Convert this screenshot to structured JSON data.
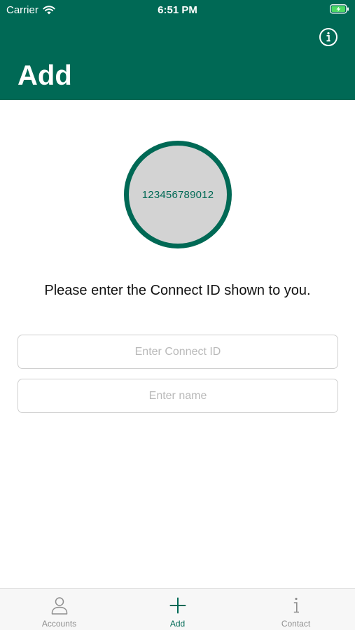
{
  "status_bar": {
    "carrier": "Carrier",
    "time": "6:51 PM"
  },
  "header": {
    "title": "Add",
    "info_icon": "info-circle-icon"
  },
  "connect_circle": {
    "id_value": "123456789012"
  },
  "instruction": "Please enter the Connect ID shown to you.",
  "form": {
    "connect_id_placeholder": "Enter Connect ID",
    "connect_id_value": "",
    "name_placeholder": "Enter name",
    "name_value": ""
  },
  "tabs": [
    {
      "label": "Accounts",
      "icon": "person-icon",
      "active": false
    },
    {
      "label": "Add",
      "icon": "plus-icon",
      "active": true
    },
    {
      "label": "Contact",
      "icon": "info-i-icon",
      "active": false
    }
  ],
  "colors": {
    "brand": "#006955",
    "circle_fill": "#d3d3d3",
    "inactive_tab": "#8e8e8e",
    "battery_charging": "#4cd964"
  }
}
